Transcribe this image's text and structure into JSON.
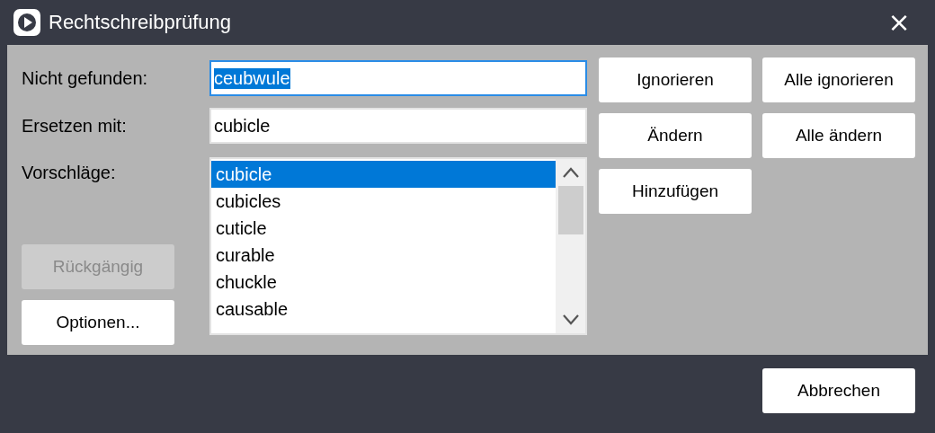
{
  "window": {
    "title": "Rechtschreibprüfung",
    "close": "×"
  },
  "fields": [
    {
      "label": "Nicht gefunden:",
      "value": "ceubwule",
      "focused": true
    },
    {
      "label": "Ersetzen mit:",
      "value": "cubicle",
      "focused": false
    }
  ],
  "suggestions": {
    "label": "Vorschläge:",
    "items": [
      {
        "text": "cubicle",
        "selected": true
      },
      {
        "text": "cubicles",
        "selected": false
      },
      {
        "text": "cuticle",
        "selected": false
      },
      {
        "text": "curable",
        "selected": false
      },
      {
        "text": "chuckle",
        "selected": false
      },
      {
        "text": "causable",
        "selected": false
      }
    ]
  },
  "left_buttons": [
    {
      "label": "Rückgängig",
      "disabled": true
    },
    {
      "label": "Optionen...",
      "disabled": false
    }
  ],
  "action_buttons": [
    {
      "label": "Ignorieren",
      "disabled": false
    },
    {
      "label": "Alle ignorieren",
      "disabled": false
    },
    {
      "label": "Ändern",
      "disabled": false
    },
    {
      "label": "Alle ändern",
      "disabled": false
    },
    {
      "label": "Hinzufügen",
      "disabled": false
    }
  ],
  "footer_button": {
    "label": "Abbrechen"
  }
}
